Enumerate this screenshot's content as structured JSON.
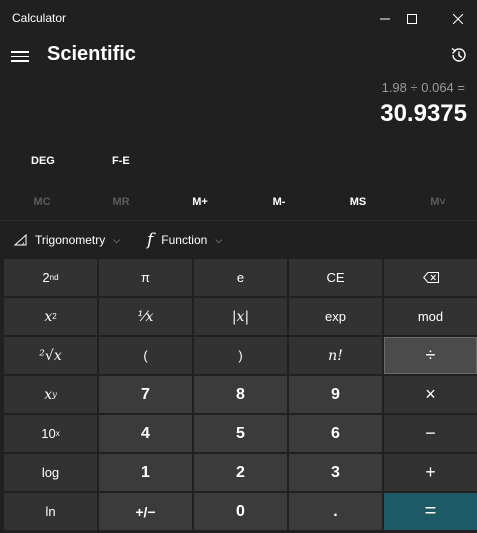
{
  "window": {
    "title": "Calculator",
    "minimize_icon": "minimize-icon",
    "maximize_icon": "maximize-icon",
    "close_icon": "close-icon"
  },
  "header": {
    "mode": "Scientific",
    "menu_icon": "hamburger-icon",
    "history_icon": "history-icon"
  },
  "display": {
    "expression": "1.98 ÷ 0.064 =",
    "result": "30.9375"
  },
  "angle": {
    "unit": "DEG",
    "fe": "F-E"
  },
  "memory": [
    {
      "label": "MC",
      "enabled": false
    },
    {
      "label": "MR",
      "enabled": false
    },
    {
      "label": "M+",
      "enabled": true
    },
    {
      "label": "M-",
      "enabled": true
    },
    {
      "label": "MS",
      "enabled": true
    },
    {
      "label": "M˅",
      "enabled": false
    }
  ],
  "functions": {
    "trig_label": "Trigonometry",
    "function_label": "Function",
    "function_glyph": "f"
  },
  "keys": {
    "second": "2",
    "second_sup": "nd",
    "pi": "π",
    "e": "e",
    "ce": "CE",
    "backspace_icon": "backspace-icon",
    "square": "x",
    "square_sup": "2",
    "reciprocal": "⅟x",
    "abs": "|x|",
    "exp": "exp",
    "mod": "mod",
    "sqrt": "²√x",
    "lparen": "(",
    "rparen": ")",
    "factorial": "n!",
    "divide": "÷",
    "power": "x",
    "power_sup": "y",
    "seven": "7",
    "eight": "8",
    "nine": "9",
    "multiply": "×",
    "ten_pow": "10",
    "ten_pow_sup": "x",
    "four": "4",
    "five": "5",
    "six": "6",
    "minus": "−",
    "log": "log",
    "one": "1",
    "two": "2",
    "three": "3",
    "plus": "+",
    "ln": "ln",
    "negate": "+/−",
    "zero": "0",
    "decimal": ".",
    "equals": "="
  }
}
